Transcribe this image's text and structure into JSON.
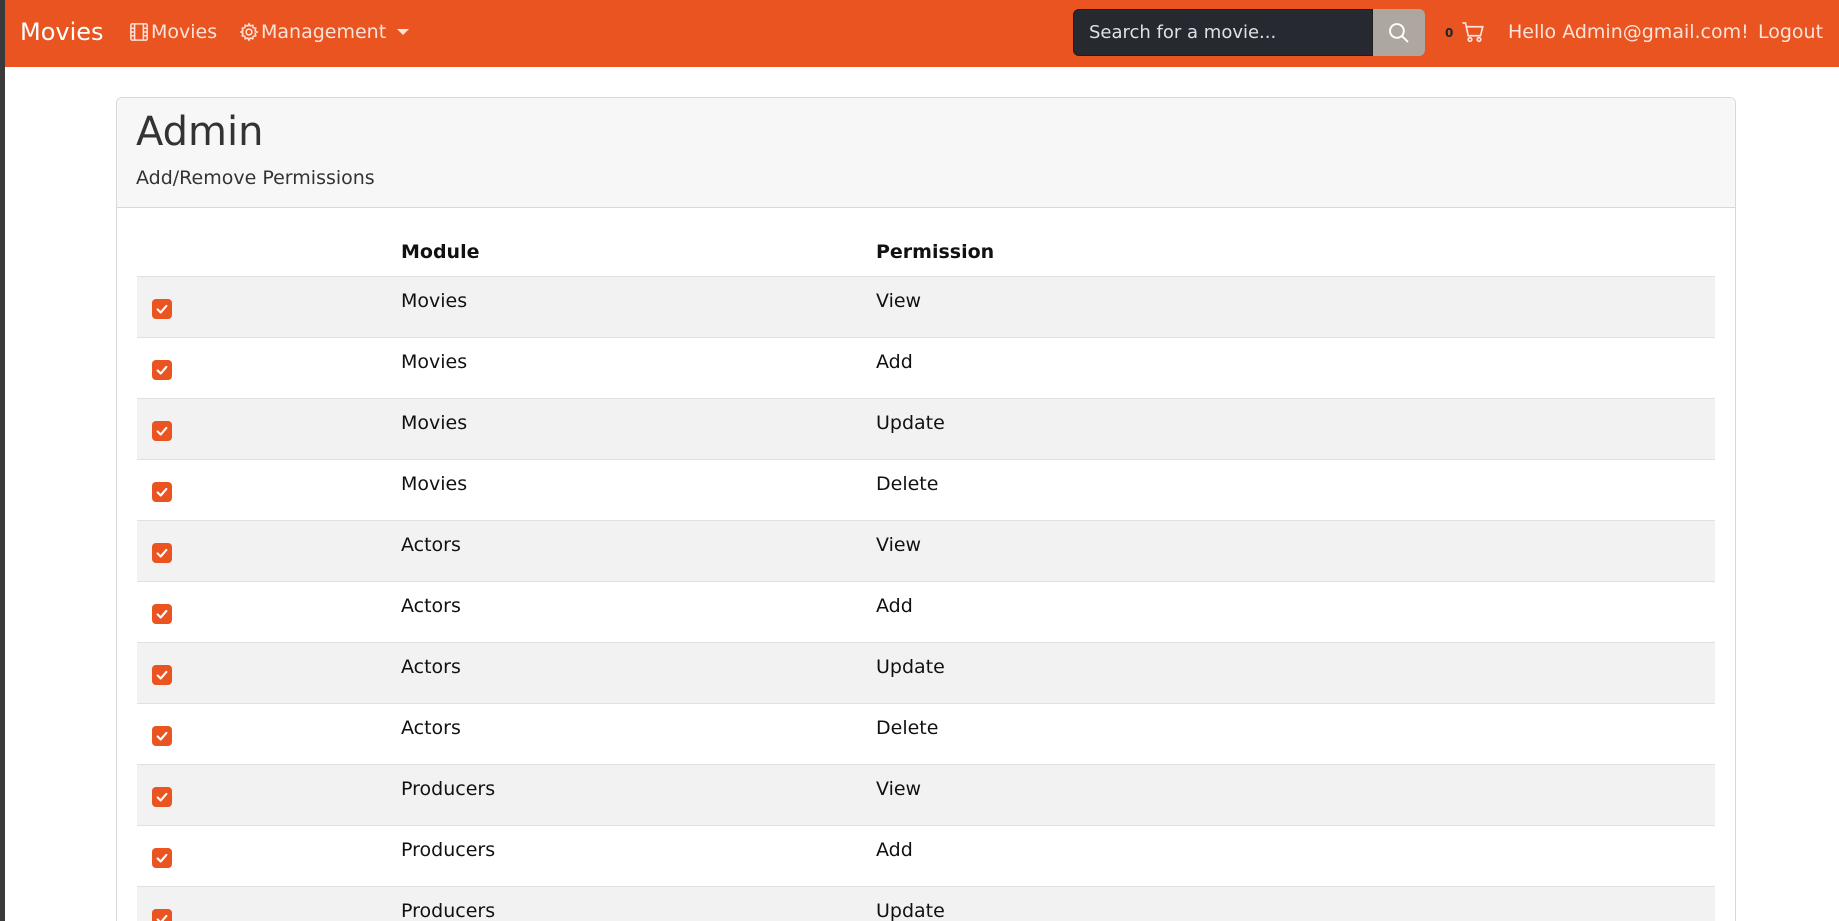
{
  "navbar": {
    "brand": "Movies",
    "movies_link": "Movies",
    "management_link": "Management",
    "search_placeholder": "Search for a movie...",
    "cart_count": "0",
    "greeting": "Hello Admin@gmail.com!",
    "logout": "Logout"
  },
  "card": {
    "title": "Admin",
    "subtitle": "Add/Remove Permissions"
  },
  "table": {
    "headers": {
      "module": "Module",
      "permission": "Permission"
    },
    "rows": [
      {
        "module": "Movies",
        "permission": "View",
        "checked": true
      },
      {
        "module": "Movies",
        "permission": "Add",
        "checked": true
      },
      {
        "module": "Movies",
        "permission": "Update",
        "checked": true
      },
      {
        "module": "Movies",
        "permission": "Delete",
        "checked": true
      },
      {
        "module": "Actors",
        "permission": "View",
        "checked": true
      },
      {
        "module": "Actors",
        "permission": "Add",
        "checked": true
      },
      {
        "module": "Actors",
        "permission": "Update",
        "checked": true
      },
      {
        "module": "Actors",
        "permission": "Delete",
        "checked": true
      },
      {
        "module": "Producers",
        "permission": "View",
        "checked": true
      },
      {
        "module": "Producers",
        "permission": "Add",
        "checked": true
      },
      {
        "module": "Producers",
        "permission": "Update",
        "checked": true
      }
    ]
  },
  "colors": {
    "accent": "#e95420",
    "search_bg": "#262a30",
    "search_button": "#aea79f"
  },
  "icons": {
    "movies": "film-icon",
    "management": "gear-icon",
    "search": "search-icon",
    "cart": "cart-icon",
    "checkbox": "checkmark-icon"
  }
}
